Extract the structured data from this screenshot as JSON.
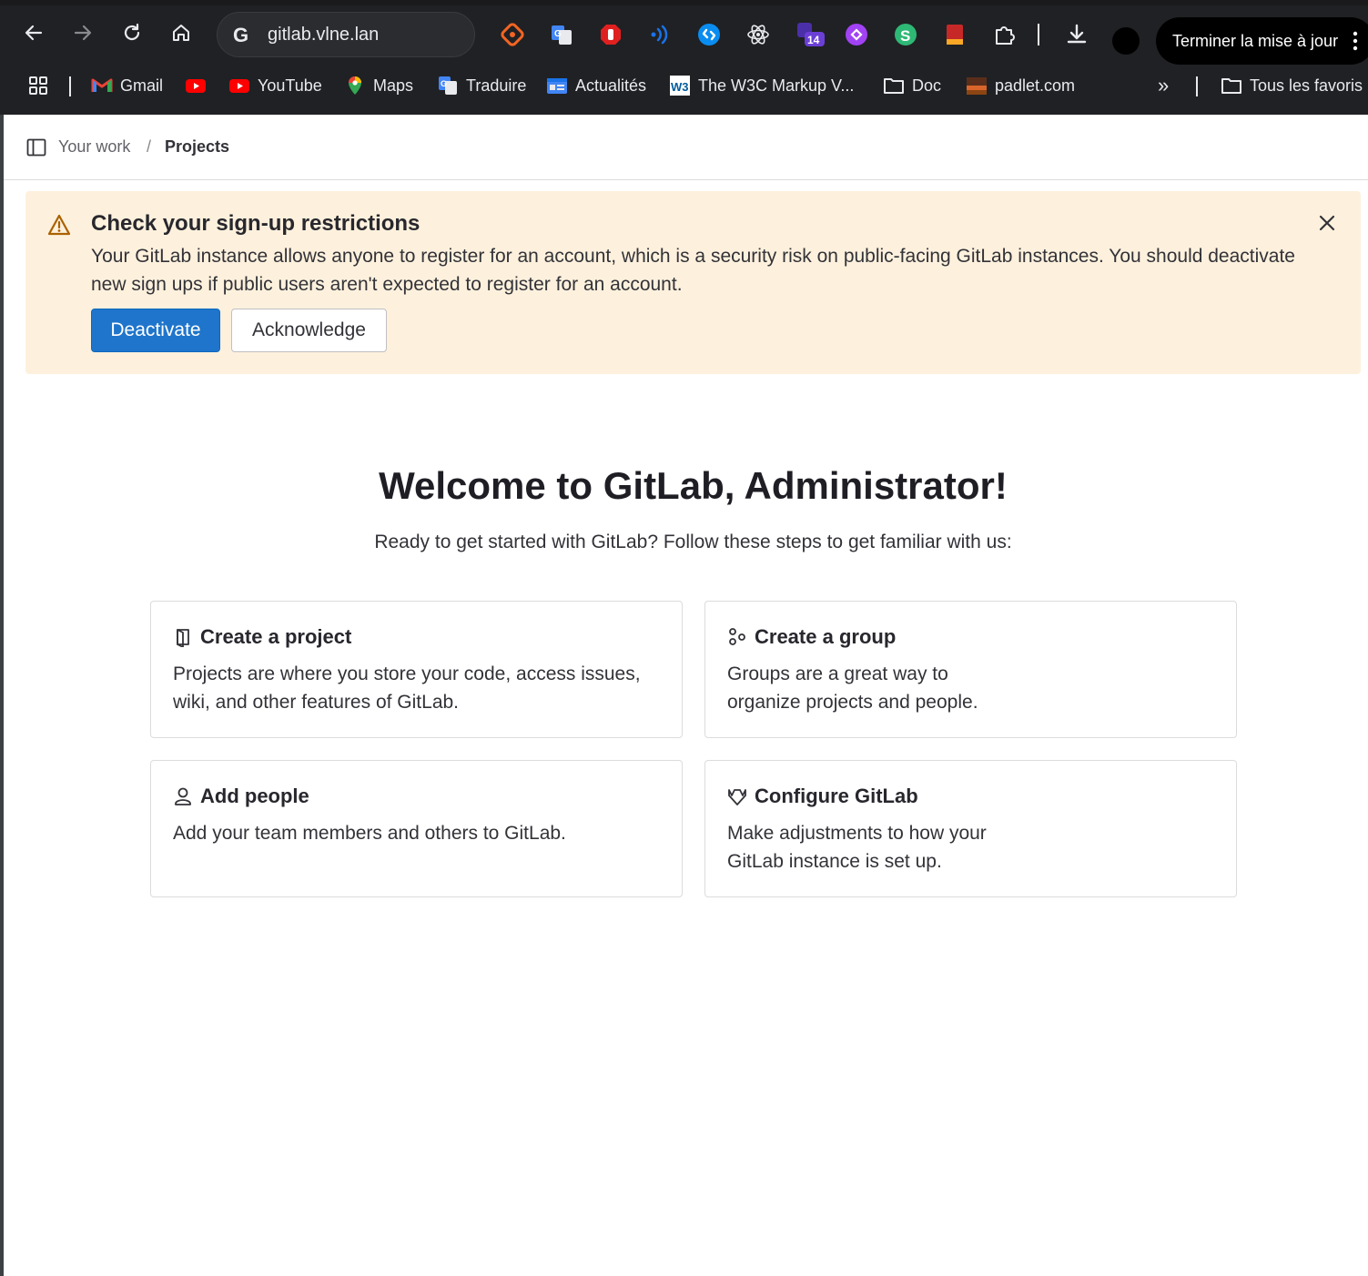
{
  "browser": {
    "url": "gitlab.vlne.lan",
    "update_label": "Terminer la mise à jour",
    "extension_badge": "14",
    "bookmarks": [
      {
        "label": "Gmail",
        "icon": "gmail-icon"
      },
      {
        "label": "",
        "icon": "youtube-icon"
      },
      {
        "label": "YouTube",
        "icon": "youtube-icon"
      },
      {
        "label": "Maps",
        "icon": "maps-icon"
      },
      {
        "label": "Traduire",
        "icon": "translate-icon"
      },
      {
        "label": "Actualités",
        "icon": "news-icon"
      },
      {
        "label": "The W3C Markup V...",
        "icon": "w3c-icon"
      },
      {
        "label": "Doc",
        "icon": "folder-icon"
      },
      {
        "label": "padlet.com",
        "icon": "padlet-icon"
      }
    ],
    "overflow_label": "»",
    "all_bookmarks_label": "Tous les favoris"
  },
  "breadcrumb": {
    "parent": "Your work",
    "separator": "/",
    "current": "Projects"
  },
  "alert": {
    "title": "Check your sign-up restrictions",
    "body": "Your GitLab instance allows anyone to register for an account, which is a security risk on public-facing GitLab instances. You should deactivate new sign ups if public users aren't expected to register for an account.",
    "deactivate_label": "Deactivate",
    "acknowledge_label": "Acknowledge"
  },
  "welcome": {
    "title": "Welcome to GitLab, Administrator!",
    "subtitle": "Ready to get started with GitLab? Follow these steps to get familiar with us:"
  },
  "cards": [
    {
      "title": "Create a project",
      "body": "Projects are where you store your code, access issues, wiki, and other features of GitLab.",
      "icon": "project-icon"
    },
    {
      "title": "Create a group",
      "body": "Groups are a great way to organize projects and people.",
      "icon": "group-icon"
    },
    {
      "title": "Add people",
      "body": "Add your team members and others to GitLab.",
      "icon": "user-icon"
    },
    {
      "title": "Configure GitLab",
      "body": "Make adjustments to how your GitLab instance is set up.",
      "icon": "tanuki-icon"
    }
  ],
  "colors": {
    "chrome_bg": "#202124",
    "alert_bg": "#fdf1dd",
    "primary_button": "#1f75cb",
    "warning_icon": "#ab6100"
  }
}
